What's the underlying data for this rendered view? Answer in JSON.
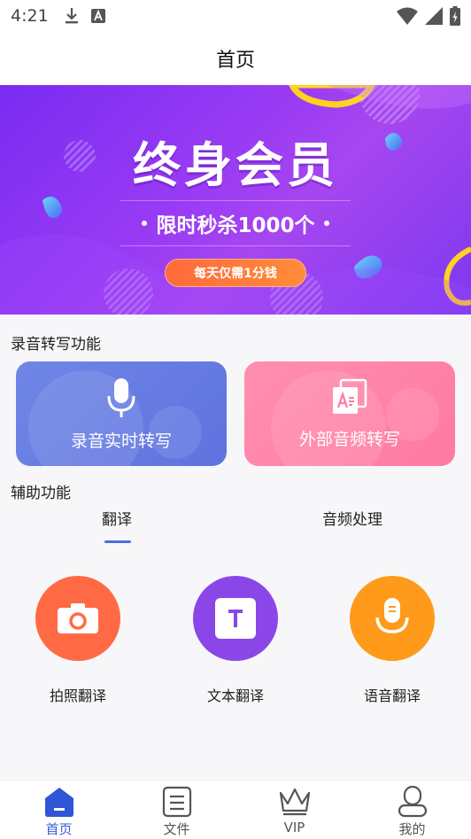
{
  "status_bar": {
    "time": "4:21",
    "icons_left": [
      "download-icon",
      "text-a-icon"
    ],
    "icons_right": [
      "wifi-icon",
      "signal-icon",
      "battery-icon"
    ]
  },
  "header": {
    "title": "首页"
  },
  "banner": {
    "title": "终身会员",
    "subtitle": "限时秒杀1000个",
    "button": "每天仅需1分钱"
  },
  "sections": {
    "recording_title": "录音转写功能",
    "assist_title": "辅助功能"
  },
  "cards": [
    {
      "label": "录音实时转写",
      "icon": "microphone-icon",
      "color": "#6a7de4"
    },
    {
      "label": "外部音频转写",
      "icon": "file-translate-icon",
      "color": "#ff84a8"
    }
  ],
  "tabs": [
    {
      "label": "翻译",
      "active": true
    },
    {
      "label": "音频处理",
      "active": false
    }
  ],
  "features": [
    {
      "label": "拍照翻译",
      "icon": "camera-icon",
      "color": "#ff6a45"
    },
    {
      "label": "文本翻译",
      "icon": "text-t-icon",
      "color": "#8b46e8"
    },
    {
      "label": "语音翻译",
      "icon": "voice-icon",
      "color": "#ff9a1a"
    }
  ],
  "tabbar": {
    "items": [
      {
        "label": "首页",
        "icon": "home-icon",
        "active": true
      },
      {
        "label": "文件",
        "icon": "file-icon",
        "active": false
      },
      {
        "label": "VIP",
        "icon": "crown-icon",
        "active": false
      },
      {
        "label": "我的",
        "icon": "profile-icon",
        "active": false
      }
    ],
    "active_color": "#3a5bd8",
    "inactive_color": "#555555"
  }
}
